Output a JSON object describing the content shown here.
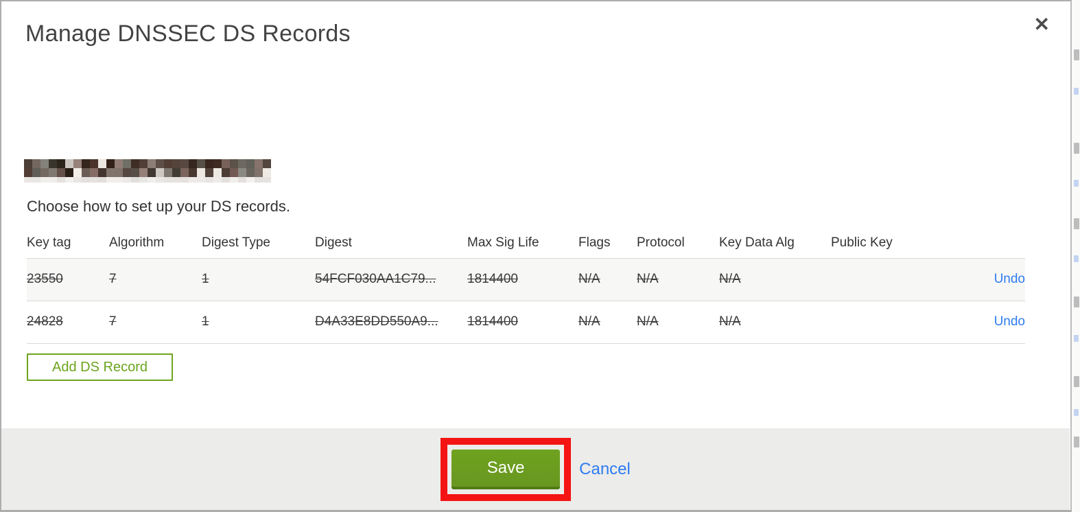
{
  "modal": {
    "title": "Manage DNSSEC DS Records",
    "close_glyph": "✕",
    "domain_redacted": true,
    "subtitle": "Choose how to set up your DS records.",
    "table": {
      "headers": [
        "Key tag",
        "Algorithm",
        "Digest Type",
        "Digest",
        "Max Sig Life",
        "Flags",
        "Protocol",
        "Key Data Alg",
        "Public Key"
      ],
      "rows": [
        {
          "cells": [
            "23550",
            "7",
            "1",
            "54FCF030AA1C79...",
            "1814400",
            "N/A",
            "N/A",
            "N/A",
            ""
          ],
          "action": "Undo",
          "deleted": true
        },
        {
          "cells": [
            "24828",
            "7",
            "1",
            "D4A33E8DD550A9...",
            "1814400",
            "N/A",
            "N/A",
            "N/A",
            ""
          ],
          "action": "Undo",
          "deleted": true
        }
      ]
    },
    "add_button_label": "Add DS Record",
    "footer": {
      "save_label": "Save",
      "cancel_label": "Cancel"
    }
  },
  "colors": {
    "accent_green": "#6ca41e",
    "save_button_green": "#6fa21f",
    "link_blue": "#2e7cf0",
    "annotation_red": "#f41414",
    "footer_gray": "#ececeb",
    "row_alt_gray": "#f7f7f6"
  }
}
